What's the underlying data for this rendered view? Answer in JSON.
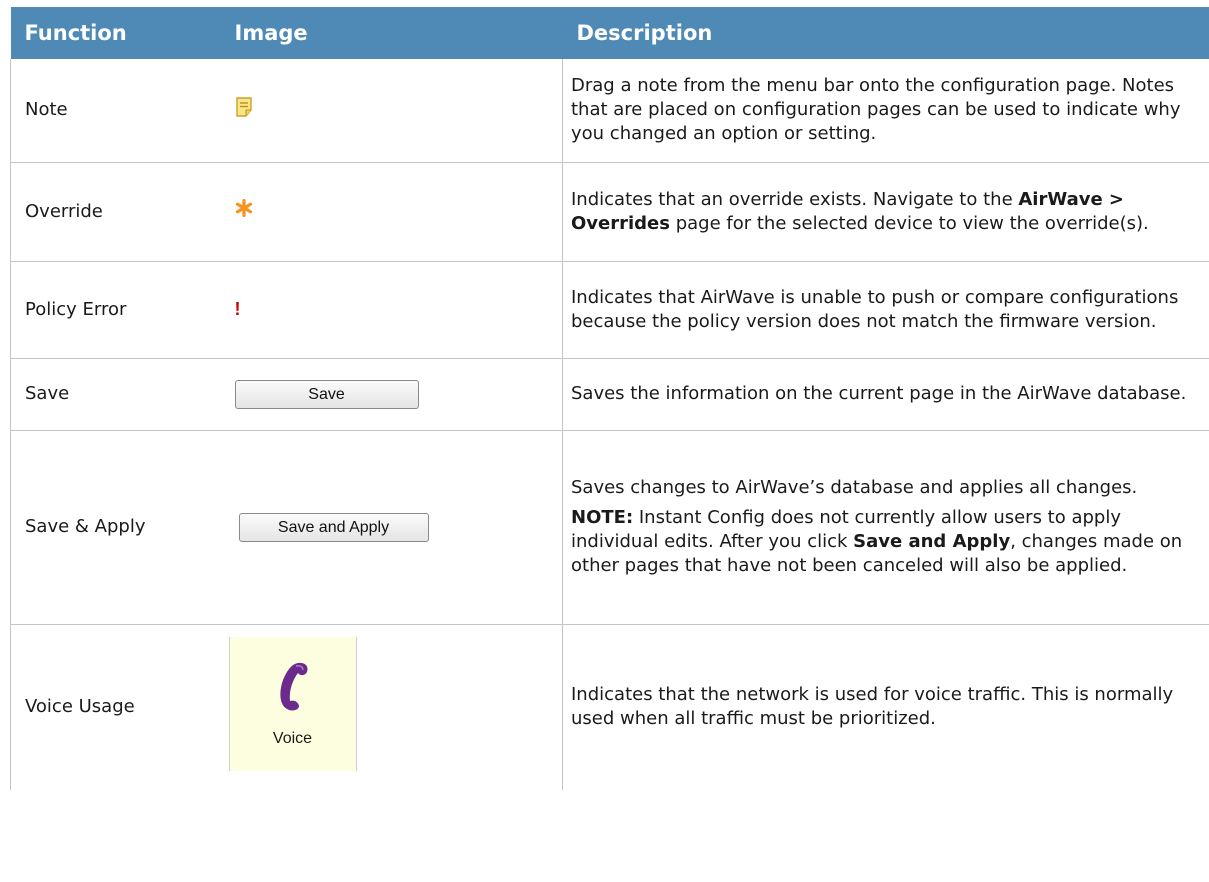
{
  "headers": {
    "function": "Function",
    "image": "Image",
    "description": "Description"
  },
  "rows": [
    {
      "function": "Note",
      "icon": "note-icon",
      "description": "Drag a note from the menu bar onto the configuration page. Notes that are placed on configuration pages can be used to indicate why you changed an option or setting."
    },
    {
      "function": "Override",
      "icon": "asterisk-icon",
      "desc_pre": "Indicates that an override exists. Navigate to the ",
      "desc_bold": "AirWave > Overrides",
      "desc_post": " page for the selected device to view the override(s)."
    },
    {
      "function": "Policy Error",
      "icon": "exclamation-icon",
      "icon_glyph": "!",
      "description": "Indicates that AirWave is unable to push or compare configurations because the policy version does not match the firmware version."
    },
    {
      "function": "Save",
      "button_label": "Save",
      "description": "Saves the information on the current page in the AirWave database."
    },
    {
      "function": "Save & Apply",
      "button_label": "Save and Apply",
      "description": "Saves changes to AirWave’s database and applies all changes.",
      "note_label": "NOTE:",
      "note_pre": " Instant Config does not currently allow users to apply individual edits. After you click ",
      "note_bold": "Save and Apply",
      "note_post": ", changes made on other pages that have not been canceled will also be applied."
    },
    {
      "function": "Voice Usage",
      "icon": "phone-icon",
      "tile_label": "Voice",
      "description": "Indicates that the network is used for voice traffic. This is normally used when all traffic must be prioritized."
    }
  ],
  "colors": {
    "header_bg": "#4f8ab7",
    "asterisk": "#f7931e",
    "error": "#cc0000",
    "phone": "#6b2a8c"
  }
}
